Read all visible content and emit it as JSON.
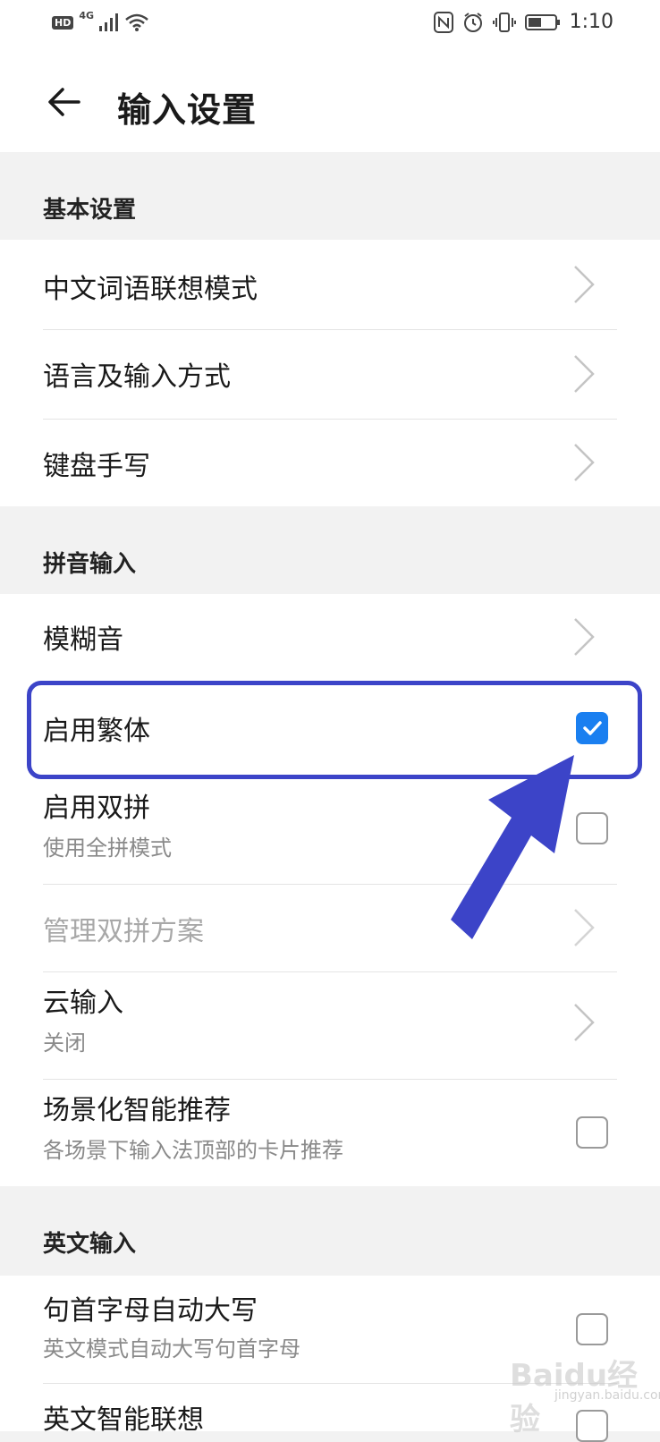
{
  "status_bar": {
    "left_badge": "HD",
    "network": "4G",
    "time": "1:10"
  },
  "header": {
    "title": "输入设置",
    "back_icon": "arrow-left-icon"
  },
  "sections": {
    "basic": {
      "title": "基本设置",
      "items": [
        {
          "label": "中文词语联想模式",
          "control": "chevron"
        },
        {
          "label": "语言及输入方式",
          "control": "chevron"
        },
        {
          "label": "键盘手写",
          "control": "chevron"
        }
      ]
    },
    "pinyin": {
      "title": "拼音输入",
      "items": [
        {
          "label": "模糊音",
          "control": "chevron"
        },
        {
          "label": "启用繁体",
          "control": "checkbox",
          "checked": true
        },
        {
          "label": "启用双拼",
          "subtitle": "使用全拼模式",
          "control": "checkbox",
          "checked": false
        },
        {
          "label": "管理双拼方案",
          "control": "chevron",
          "disabled": true
        },
        {
          "label": "云输入",
          "subtitle": "关闭",
          "control": "chevron"
        },
        {
          "label": "场景化智能推荐",
          "subtitle": "各场景下输入法顶部的卡片推荐",
          "control": "checkbox",
          "checked": false
        }
      ]
    },
    "english": {
      "title": "英文输入",
      "items": [
        {
          "label": "句首字母自动大写",
          "subtitle": "英文模式自动大写句首字母",
          "control": "checkbox",
          "checked": false
        },
        {
          "label": "英文智能联想",
          "control": "checkbox",
          "checked": false
        }
      ]
    }
  },
  "annotation": {
    "highlight_color": "#3c44c8",
    "arrow_color": "#3c44c8"
  },
  "colors": {
    "accent": "#1a7ff0",
    "background": "#f2f2f2",
    "card": "#ffffff"
  },
  "watermark": {
    "text": "Baidu经验",
    "sub": "jingyan.baidu.com"
  }
}
